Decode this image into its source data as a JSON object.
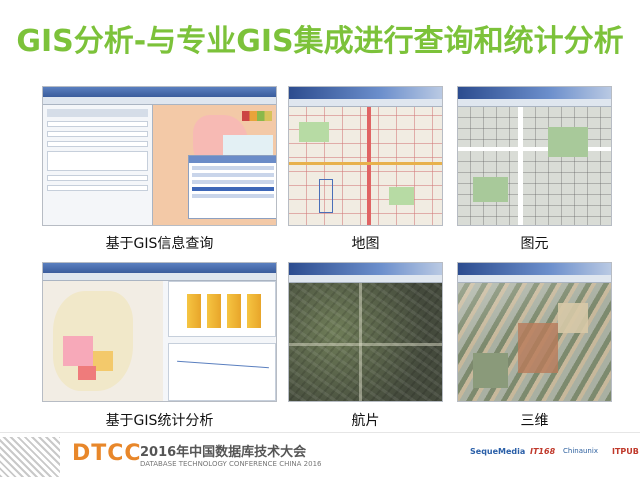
{
  "slide": {
    "title": "GIS分析-与专业GIS集成进行查询和统计分析"
  },
  "panels": [
    {
      "caption": "基于GIS信息查询",
      "icon": "gis-query-screenshot"
    },
    {
      "caption": "地图",
      "icon": "street-map-screenshot"
    },
    {
      "caption": "图元",
      "icon": "vector-map-screenshot"
    },
    {
      "caption": "基于GIS统计分析",
      "icon": "gis-statistics-screenshot"
    },
    {
      "caption": "航片",
      "icon": "aerial-photo-screenshot"
    },
    {
      "caption": "三维",
      "icon": "3d-view-screenshot"
    }
  ],
  "footer": {
    "logo_text": "DTCC",
    "conference_cn": "2016年中国数据库技术大会",
    "conference_en": "DATABASE TECHNOLOGY CONFERENCE CHINA 2016",
    "sponsors": [
      "SequeMedia",
      "IT168",
      "Chinaunix",
      "ITPUB"
    ]
  },
  "colors": {
    "title": "#7cc23a",
    "footer_orange": "#e8872a",
    "footer_text": "#555555"
  }
}
